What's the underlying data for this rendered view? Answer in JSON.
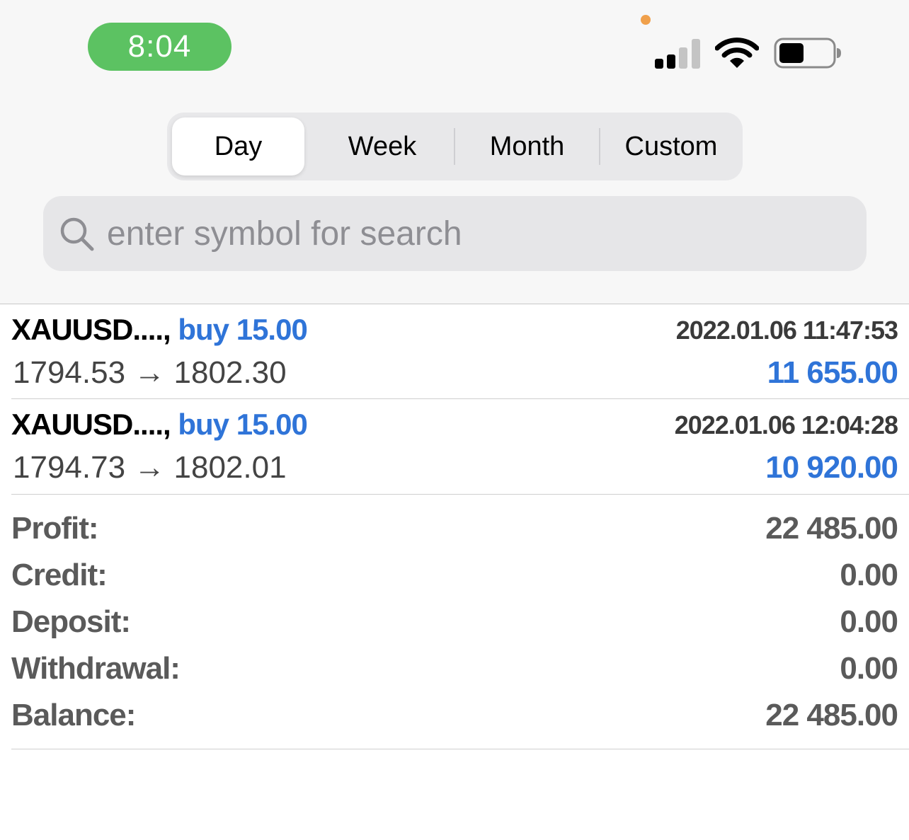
{
  "status_bar": {
    "time": "8:04",
    "icons": [
      "microphone-indicator-dot",
      "cellular-signal-icon",
      "wifi-icon",
      "battery-icon"
    ]
  },
  "period_tabs": {
    "items": [
      {
        "label": "Day",
        "selected": true
      },
      {
        "label": "Week",
        "selected": false
      },
      {
        "label": "Month",
        "selected": false
      },
      {
        "label": "Custom",
        "selected": false
      }
    ]
  },
  "search": {
    "placeholder": "enter symbol for search",
    "value": ""
  },
  "deals": [
    {
      "symbol": "XAUUSD....,",
      "type": "buy 15.00",
      "time": "2022.01.06 11:47:53",
      "prices": "1794.53 → 1802.30",
      "profit": "11 655.00"
    },
    {
      "symbol": "XAUUSD....,",
      "type": "buy 15.00",
      "time": "2022.01.06 12:04:28",
      "prices": "1794.73 → 1802.01",
      "profit": "10 920.00"
    }
  ],
  "summary": [
    {
      "label": "Profit:",
      "value": "22 485.00"
    },
    {
      "label": "Credit:",
      "value": "0.00"
    },
    {
      "label": "Deposit:",
      "value": "0.00"
    },
    {
      "label": "Withdrawal:",
      "value": "0.00"
    },
    {
      "label": "Balance:",
      "value": "22 485.00"
    }
  ],
  "colors": {
    "accent_blue": "#2f74d8",
    "time_pill_green": "#5cc262",
    "summary_text": "#5a5a5a"
  }
}
